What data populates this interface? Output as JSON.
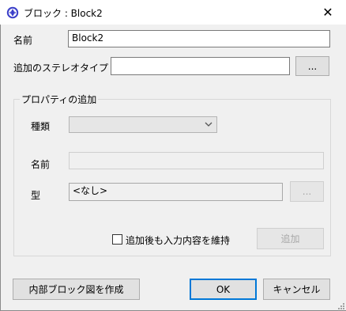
{
  "window": {
    "title": "ブロック : Block2",
    "close_label": "✕"
  },
  "name_row": {
    "label": "名前",
    "value": "Block2"
  },
  "stereotype_row": {
    "label": "追加のステレオタイプ",
    "value": "",
    "browse_label": "..."
  },
  "property_group": {
    "title": "プロパティの追加",
    "kind_label": "種類",
    "kind_value": "",
    "name_label": "名前",
    "name_value": "",
    "type_label": "型",
    "type_value": "<なし>",
    "type_browse_label": "...",
    "keep_input_label": "追加後も入力内容を維持",
    "keep_input_checked": false,
    "add_label": "追加"
  },
  "footer": {
    "create_ibd_label": "内部ブロック図を作成",
    "ok_label": "OK",
    "cancel_label": "キャンセル"
  }
}
